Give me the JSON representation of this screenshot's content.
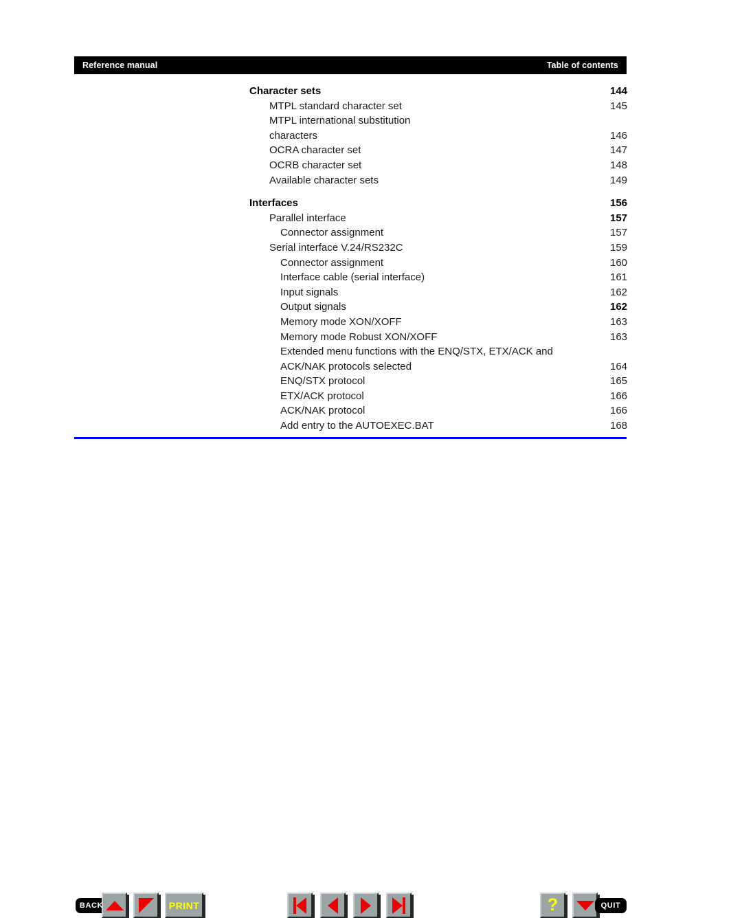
{
  "header": {
    "left_label": "Reference manual",
    "right_label": "Table of contents"
  },
  "toc": {
    "entries": [
      {
        "level": 0,
        "label": "Character sets",
        "page": "144",
        "bold": true,
        "cont": false,
        "gap_before": false,
        "bold_page": true
      },
      {
        "level": 1,
        "label": "MTPL standard character set",
        "page": "145",
        "bold": false,
        "cont": false,
        "gap_before": false,
        "bold_page": false
      },
      {
        "level": 1,
        "label": "MTPL international substitution",
        "page": "",
        "bold": false,
        "cont": true,
        "gap_before": false,
        "bold_page": false
      },
      {
        "level": 1,
        "label": "characters",
        "page": "146",
        "bold": false,
        "cont": false,
        "gap_before": false,
        "bold_page": false
      },
      {
        "level": 1,
        "label": "OCRA character set",
        "page": "147",
        "bold": false,
        "cont": false,
        "gap_before": false,
        "bold_page": false
      },
      {
        "level": 1,
        "label": "OCRB  character set",
        "page": "148",
        "bold": false,
        "cont": false,
        "gap_before": false,
        "bold_page": false
      },
      {
        "level": 1,
        "label": "Available character sets",
        "page": "149",
        "bold": false,
        "cont": false,
        "gap_before": false,
        "bold_page": false
      },
      {
        "level": 0,
        "label": "Interfaces",
        "page": "156",
        "bold": true,
        "cont": false,
        "gap_before": true,
        "bold_page": true
      },
      {
        "level": 1,
        "label": "Parallel interface",
        "page": "157",
        "bold": false,
        "cont": false,
        "gap_before": false,
        "bold_page": true
      },
      {
        "level": 2,
        "label": "Connector assignment",
        "page": "157",
        "bold": false,
        "cont": false,
        "gap_before": false,
        "bold_page": false
      },
      {
        "level": 1,
        "label": "Serial interface V.24/RS232C",
        "page": "159",
        "bold": false,
        "cont": false,
        "gap_before": false,
        "bold_page": false
      },
      {
        "level": 2,
        "label": "Connector assignment",
        "page": "160",
        "bold": false,
        "cont": false,
        "gap_before": false,
        "bold_page": false
      },
      {
        "level": 2,
        "label": "Interface cable (serial interface)",
        "page": "161",
        "bold": false,
        "cont": false,
        "gap_before": false,
        "bold_page": false
      },
      {
        "level": 2,
        "label": "Input signals",
        "page": "162",
        "bold": false,
        "cont": false,
        "gap_before": false,
        "bold_page": false
      },
      {
        "level": 2,
        "label": "Output signals",
        "page": "162",
        "bold": false,
        "cont": false,
        "gap_before": false,
        "bold_page": true
      },
      {
        "level": 2,
        "label": "Memory mode XON/XOFF",
        "page": "163",
        "bold": false,
        "cont": false,
        "gap_before": false,
        "bold_page": false
      },
      {
        "level": 2,
        "label": "Memory mode Robust XON/XOFF",
        "page": "163",
        "bold": false,
        "cont": false,
        "gap_before": false,
        "bold_page": false
      },
      {
        "level": 2,
        "label": "Extended menu functions with the ENQ/STX, ETX/ACK and",
        "page": "",
        "bold": false,
        "cont": true,
        "gap_before": false,
        "bold_page": false
      },
      {
        "level": 2,
        "label": "ACK/NAK protocols selected",
        "page": "164",
        "bold": false,
        "cont": false,
        "gap_before": false,
        "bold_page": false
      },
      {
        "level": 2,
        "label": "ENQ/STX protocol",
        "page": "165",
        "bold": false,
        "cont": false,
        "gap_before": false,
        "bold_page": false
      },
      {
        "level": 2,
        "label": "ETX/ACK protocol",
        "page": "166",
        "bold": false,
        "cont": false,
        "gap_before": false,
        "bold_page": false
      },
      {
        "level": 2,
        "label": "ACK/NAK protocol",
        "page": "166",
        "bold": false,
        "cont": false,
        "gap_before": false,
        "bold_page": false
      },
      {
        "level": 2,
        "label": "Add entry to the AUTOEXEC.BAT",
        "page": "168",
        "bold": false,
        "cont": false,
        "gap_before": false,
        "bold_page": false
      }
    ]
  },
  "toolbar": {
    "back_label": "BACK",
    "print_label": "PRINT",
    "quit_label": "QUIT",
    "help_label": "?",
    "icons": {
      "scroll_up": "triangle-up-icon",
      "page_corner": "triangle-corner-icon",
      "first_page": "first-page-icon",
      "prev_page": "previous-page-icon",
      "next_page": "next-page-icon",
      "last_page": "last-page-icon",
      "scroll_down": "triangle-down-icon"
    }
  },
  "colors": {
    "rule": "#0000ff",
    "button_face": "#9ca5a5",
    "glyph_red": "#ee0000",
    "glyph_yellow": "#ffff00",
    "header_bg": "#000000"
  }
}
